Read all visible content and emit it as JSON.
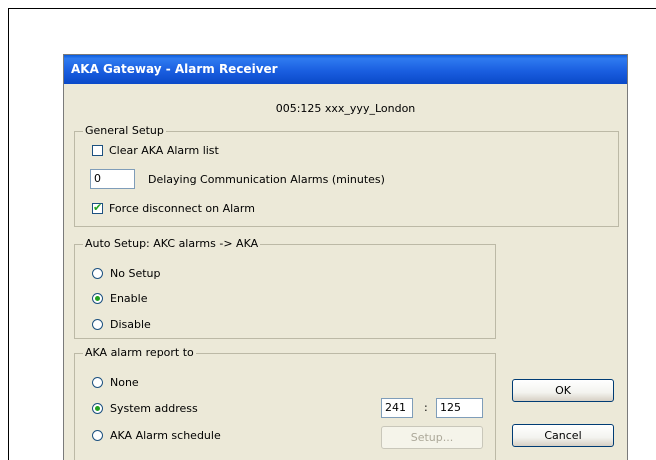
{
  "window": {
    "title": "AKA  Gateway - Alarm Receiver"
  },
  "subtitle": "005:125  xxx_yyy_London",
  "general_setup": {
    "legend": "General Setup",
    "clear_list": {
      "label": "Clear AKA Alarm list",
      "checked": false
    },
    "delay": {
      "value": "0",
      "label": "Delaying Communication Alarms (minutes)"
    },
    "force_disconnect": {
      "label": "Force disconnect on Alarm",
      "checked": true
    }
  },
  "auto_setup": {
    "legend": "Auto Setup: AKC alarms -> AKA",
    "options": [
      {
        "label": "No Setup",
        "selected": false
      },
      {
        "label": "Enable",
        "selected": true
      },
      {
        "label": "Disable",
        "selected": false
      }
    ]
  },
  "report_to": {
    "legend": "AKA alarm report to",
    "options": [
      {
        "label": "None",
        "selected": false
      },
      {
        "label": "System address",
        "selected": true
      },
      {
        "label": "AKA Alarm schedule",
        "selected": false
      }
    ],
    "address_1": "241",
    "separator": ":",
    "address_2": "125",
    "setup_button": "Setup..."
  },
  "buttons": {
    "ok": "OK",
    "cancel": "Cancel"
  }
}
